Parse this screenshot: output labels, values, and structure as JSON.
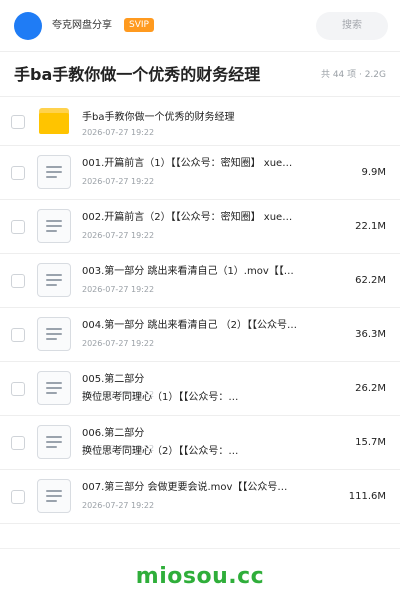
{
  "header": {
    "user_name": "夸克网盘分享",
    "vip_badge": "SVIP",
    "search_label": "搜索",
    "colors": {
      "avatar": "#1f7cf5",
      "badge": "#ff9a1f"
    }
  },
  "title_bar": {
    "title": "手ba手教你做一个优秀的财务经理",
    "summary": "共 44 项 · 2.2G"
  },
  "files": [
    {
      "type": "folder",
      "name": "手ba手教你做一个优秀的财务经理",
      "date": "2026-07-27 19:22",
      "size": ""
    },
    {
      "type": "file",
      "name": "001.开篇前言（1）【【公众号：密知圈】 xue…",
      "date": "2026-07-27 19:22",
      "size": "9.9M"
    },
    {
      "type": "file",
      "name": "002.开篇前言（2）【【公众号：密知圈】 xue…",
      "date": "2026-07-27 19:22",
      "size": "22.1M"
    },
    {
      "type": "file",
      "name": "003.第一部分 跳出来看清自己（1）.mov【【…",
      "date": "2026-07-27 19:22",
      "size": "62.2M"
    },
    {
      "type": "file",
      "name": "004.第一部分 跳出来看清自己 （2）【【公众号…",
      "date": "2026-07-27 19:22",
      "size": "36.3M"
    },
    {
      "type": "file",
      "name_line1": "005.第二部分",
      "name_line2": "换位思考同理心（1）【【公众号：…",
      "date": "2026-07-27 19:22",
      "size": "26.2M"
    },
    {
      "type": "file",
      "name_line1": "006.第二部分",
      "name_line2": "换位思考同理心（2）【【公众号：…",
      "date": "2026-07-27 19:22",
      "size": "15.7M"
    },
    {
      "type": "file",
      "name": "007.第三部分 会做更要会说.mov【【公众号…",
      "date": "2026-07-27 19:22",
      "size": "111.6M"
    }
  ],
  "footer": {
    "watermark": "miosou.cc",
    "watermark_color": "#2fae3a"
  }
}
